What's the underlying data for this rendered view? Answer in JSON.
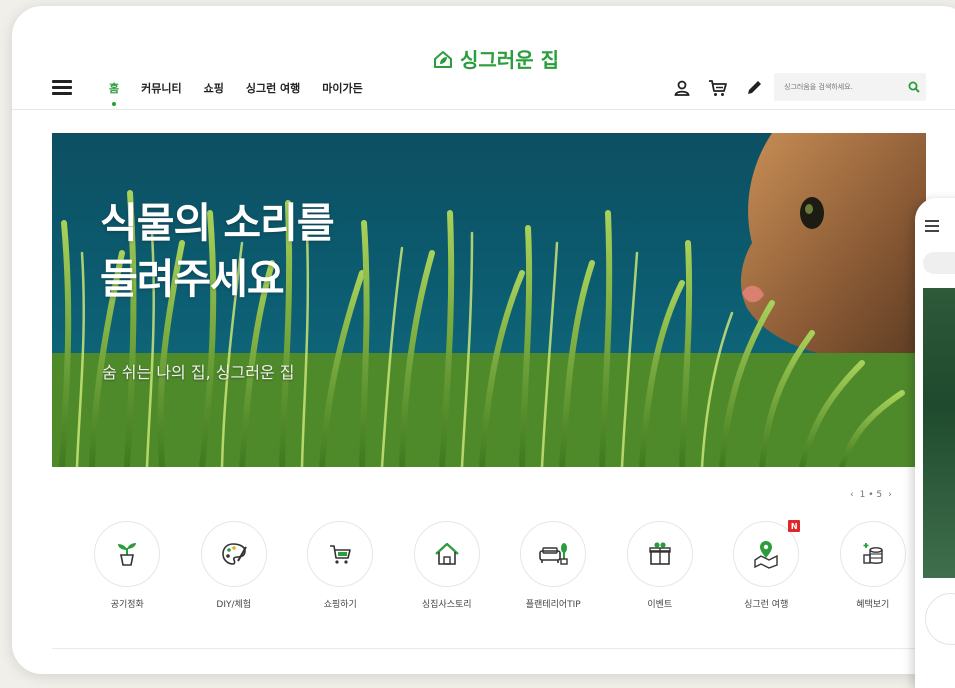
{
  "header": {
    "logo_text": "싱그러운 집",
    "nav": [
      {
        "label": "홈",
        "active": true
      },
      {
        "label": "커뮤니티",
        "active": false
      },
      {
        "label": "쇼핑",
        "active": false
      },
      {
        "label": "싱그런 여행",
        "active": false
      },
      {
        "label": "마이가든",
        "active": false
      }
    ],
    "icons": [
      "user-icon",
      "cart-icon",
      "pencil-icon"
    ],
    "search": {
      "placeholder": "싱그러움을 검색하세요.",
      "icon": "search-icon"
    }
  },
  "hero": {
    "title_line1": "식물의 소리를",
    "title_line2": "들려주세요",
    "subtitle": "숨 쉬는 나의 집, 싱그러운 집"
  },
  "pager": {
    "text": "1 • 5",
    "prev": "‹",
    "next": "›"
  },
  "categories": [
    {
      "label": "공기정화",
      "icon": "sprout-pot-icon"
    },
    {
      "label": "DIY/체험",
      "icon": "palette-icon"
    },
    {
      "label": "쇼핑하기",
      "icon": "shopping-cart-icon"
    },
    {
      "label": "싱집사스토리",
      "icon": "house-icon"
    },
    {
      "label": "플랜테리어TIP",
      "icon": "sofa-plant-icon"
    },
    {
      "label": "이벤트",
      "icon": "gift-icon"
    },
    {
      "label": "싱그런 여행",
      "icon": "map-pin-icon",
      "badge": "N"
    },
    {
      "label": "혜택보기",
      "icon": "coins-icon"
    }
  ],
  "colors": {
    "brand": "#2a9d3c",
    "badge": "#e02828",
    "hero_bg": "#0f5d71"
  }
}
